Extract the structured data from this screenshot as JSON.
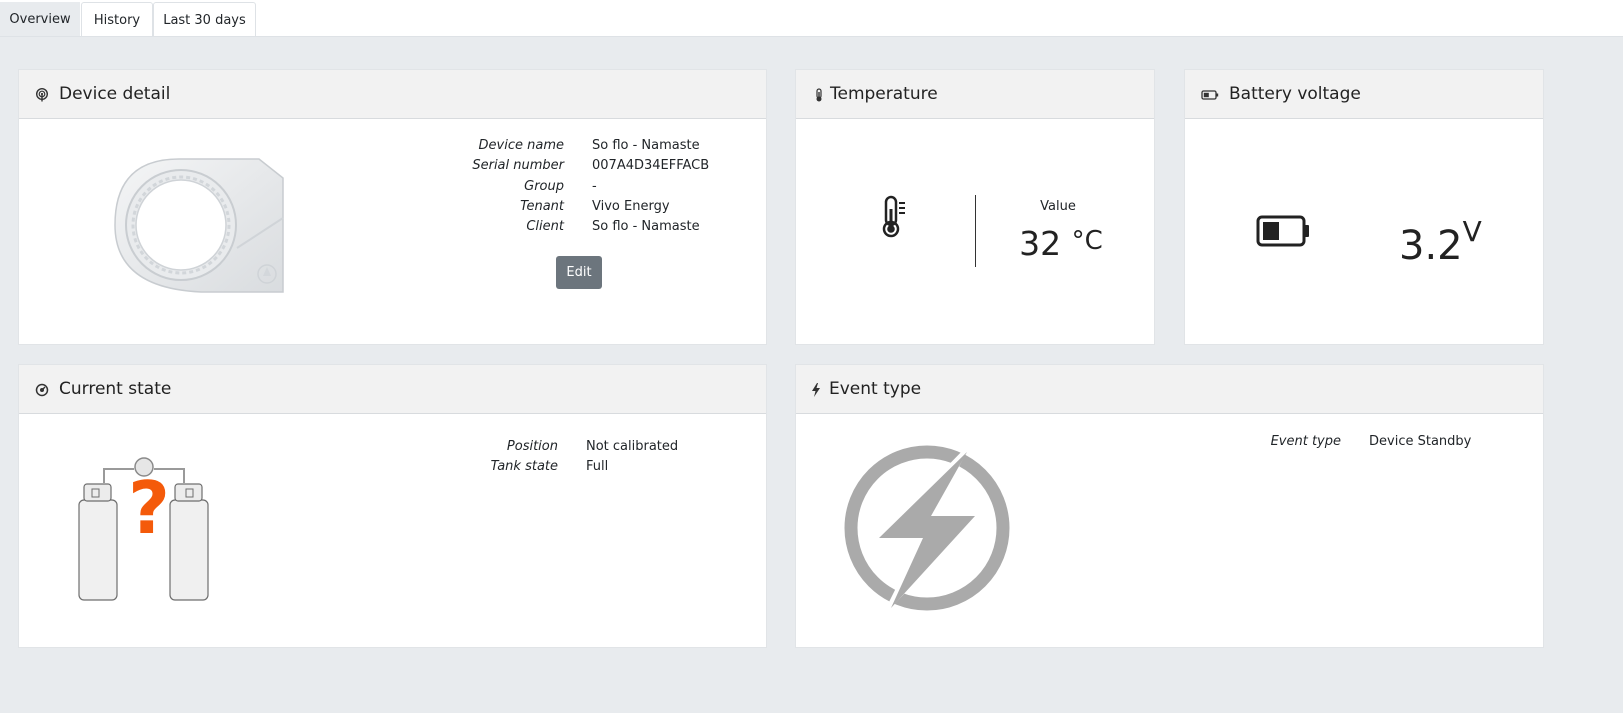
{
  "tabs": [
    {
      "label": "Overview",
      "active": true
    },
    {
      "label": "History",
      "active": false
    },
    {
      "label": "Last 30 days",
      "active": false
    }
  ],
  "device_detail": {
    "title": "Device detail",
    "rows": [
      {
        "key": "Device name",
        "value": "So flo - Namaste"
      },
      {
        "key": "Serial number",
        "value": "007A4D34EFFACB"
      },
      {
        "key": "Group",
        "value": "-"
      },
      {
        "key": "Tenant",
        "value": "Vivo Energy"
      },
      {
        "key": "Client",
        "value": "So flo - Namaste"
      }
    ],
    "edit_label": "Edit"
  },
  "temperature": {
    "title": "Temperature",
    "value_label": "Value",
    "value": "32",
    "unit": "°C"
  },
  "battery": {
    "title": "Battery voltage",
    "value": "3.2",
    "unit": "V",
    "level": 0.45
  },
  "current_state": {
    "title": "Current state",
    "rows": [
      {
        "key": "Position",
        "value": "Not calibrated"
      },
      {
        "key": "Tank state",
        "value": "Full"
      }
    ],
    "question_glyph": "?"
  },
  "event_type": {
    "title": "Event type",
    "rows": [
      {
        "key": "Event type",
        "value": "Device Standby"
      }
    ]
  },
  "colors": {
    "background": "#e8ebee",
    "card_header": "#f2f2f2",
    "edit_button": "#6c757d",
    "question_mark": "#f45a0a",
    "event_icon": "#aaaaaa"
  }
}
